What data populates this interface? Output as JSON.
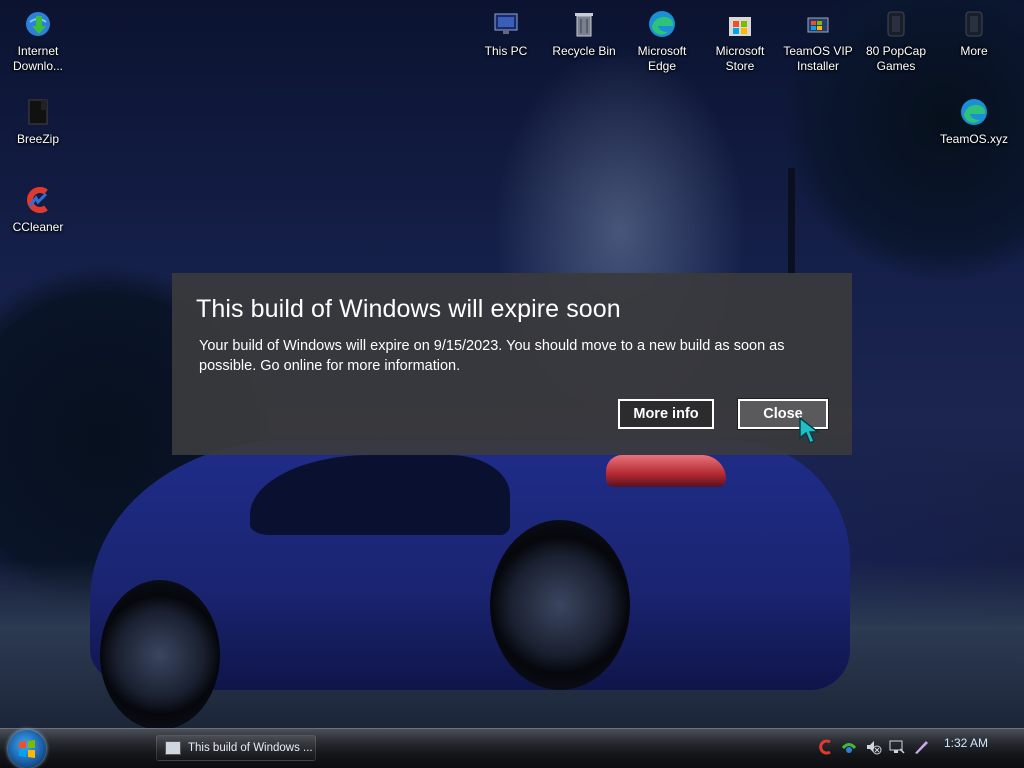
{
  "desktop": {
    "icons": [
      {
        "label": "Internet Downlo...",
        "icon": "internet-download-manager-icon"
      },
      {
        "label": "BreeZip",
        "icon": "breezip-icon"
      },
      {
        "label": "CCleaner",
        "icon": "ccleaner-icon"
      },
      {
        "label": "This PC",
        "icon": "this-pc-icon"
      },
      {
        "label": "Recycle Bin",
        "icon": "recycle-bin-icon"
      },
      {
        "label": "Microsoft Edge",
        "icon": "edge-icon"
      },
      {
        "label": "Microsoft Store",
        "icon": "store-icon"
      },
      {
        "label": "TeamOS VIP Installer",
        "icon": "installer-icon"
      },
      {
        "label": "80 PopCap Games",
        "icon": "popcap-games-icon"
      },
      {
        "label": "More",
        "icon": "more-icon"
      },
      {
        "label": "TeamOS.xyz",
        "icon": "teamos-edge-icon"
      }
    ]
  },
  "dialog": {
    "title": "This build of Windows will expire soon",
    "message": "Your build of Windows will expire on 9/15/2023. You should move to a new build as soon as possible. Go online for more information.",
    "more_info_label": "More info",
    "close_label": "Close"
  },
  "taskbar": {
    "task_item_label": "This build of Windows ...",
    "clock": "1:32 AM"
  },
  "colors": {
    "dialog_bg": "#3a3a3c",
    "taskbar": "#15171b",
    "start_orb": "#1b5fa8"
  }
}
